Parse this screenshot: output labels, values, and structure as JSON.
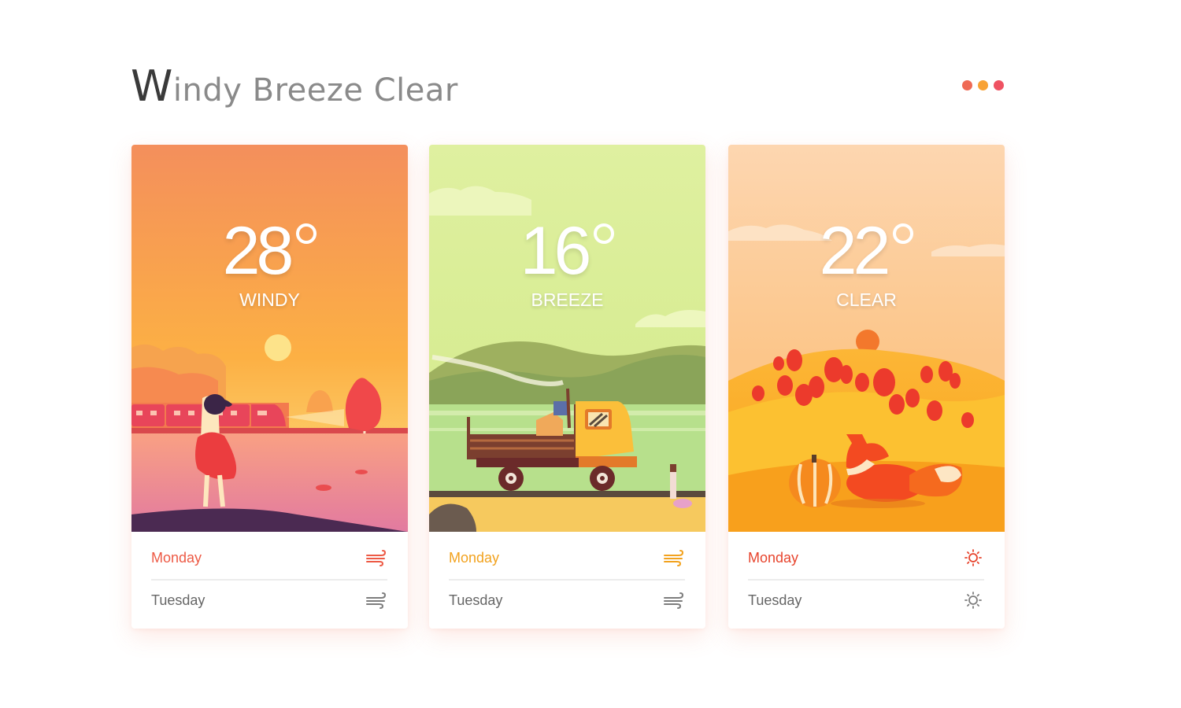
{
  "header": {
    "title_first_letter": "W",
    "title_rest": "indy Breeze Clear",
    "menu_dots_colors": [
      "#ef6a55",
      "#f8a234",
      "#ef5262"
    ],
    "menu_icon": "more-dots-icon"
  },
  "colors": {
    "windy_accent": "#ed5a45",
    "breeze_accent": "#f2a21e",
    "clear_accent": "#e7442d",
    "muted_text": "#666666",
    "muted_icon": "#7d7d7d"
  },
  "cards": [
    {
      "temperature": "28",
      "condition": "WINDY",
      "scene": "girl-by-train-at-sunset",
      "days": [
        {
          "label": "Monday",
          "icon": "wind-icon"
        },
        {
          "label": "Tuesday",
          "icon": "wind-icon"
        }
      ]
    },
    {
      "temperature": "16",
      "condition": "BREEZE",
      "scene": "truck-in-green-hills",
      "days": [
        {
          "label": "Monday",
          "icon": "wind-icon"
        },
        {
          "label": "Tuesday",
          "icon": "wind-icon"
        }
      ]
    },
    {
      "temperature": "22",
      "condition": "CLEAR",
      "scene": "fox-and-pumpkin-in-autumn-field",
      "days": [
        {
          "label": "Monday",
          "icon": "sun-icon"
        },
        {
          "label": "Tuesday",
          "icon": "sun-icon"
        }
      ]
    }
  ]
}
